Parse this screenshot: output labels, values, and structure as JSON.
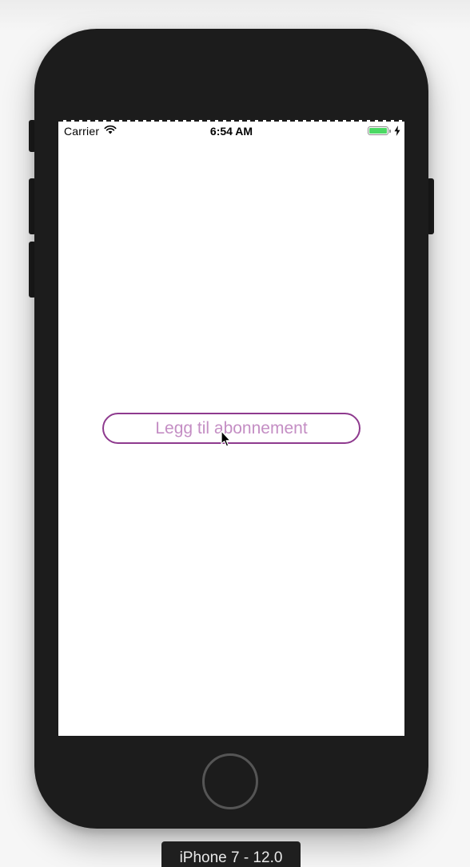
{
  "status_bar": {
    "carrier": "Carrier",
    "time": "6:54 AM",
    "battery_level": 1.0,
    "battery_color": "#4cd964",
    "charging": true
  },
  "main": {
    "add_subscription_label": "Legg til abonnement",
    "button_border_color": "#8e3a8e",
    "button_text_color": "#c48ec4"
  },
  "simulator": {
    "device_label": "iPhone 7 - 12.0"
  },
  "icons": {
    "wifi": "wifi-icon",
    "battery": "battery-icon",
    "charging": "charging-bolt-icon",
    "cursor": "mouse-pointer-icon"
  }
}
